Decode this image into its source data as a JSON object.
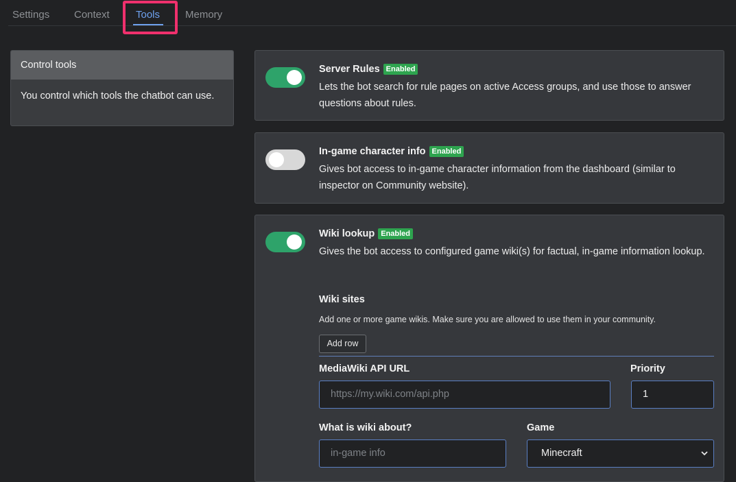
{
  "tabs": [
    {
      "label": "Settings"
    },
    {
      "label": "Context"
    },
    {
      "label": "Tools"
    },
    {
      "label": "Memory"
    }
  ],
  "info_panel": {
    "title": "Control tools",
    "body": "You control which tools the chatbot can use."
  },
  "tools": [
    {
      "title": "Server Rules",
      "badge": "Enabled",
      "enabled": true,
      "description": "Lets the bot search for rule pages on active Access groups, and use those to answer questions about rules."
    },
    {
      "title": "In-game character info",
      "badge": "Enabled",
      "enabled": false,
      "description": "Gives bot access to in-game character information from the dashboard (similar to inspector on Community website)."
    },
    {
      "title": "Wiki lookup",
      "badge": "Enabled",
      "enabled": true,
      "description": "Gives the bot access to configured game wiki(s) for factual, in-game information lookup."
    }
  ],
  "wiki": {
    "section_title": "Wiki sites",
    "section_desc": "Add one or more game wikis. Make sure you are allowed to use them in your community.",
    "add_row_label": "Add row",
    "api_url_label": "MediaWiki API URL",
    "api_url_placeholder": "https://my.wiki.com/api.php",
    "priority_label": "Priority",
    "priority_value": "1",
    "about_label": "What is wiki about?",
    "about_placeholder": "in-game info",
    "game_label": "Game",
    "game_value": "Minecraft"
  },
  "colors": {
    "accent": "#6ea1ee",
    "toggle_on": "#2ea36a",
    "badge": "#2ea44f",
    "highlight": "#f0306d"
  }
}
